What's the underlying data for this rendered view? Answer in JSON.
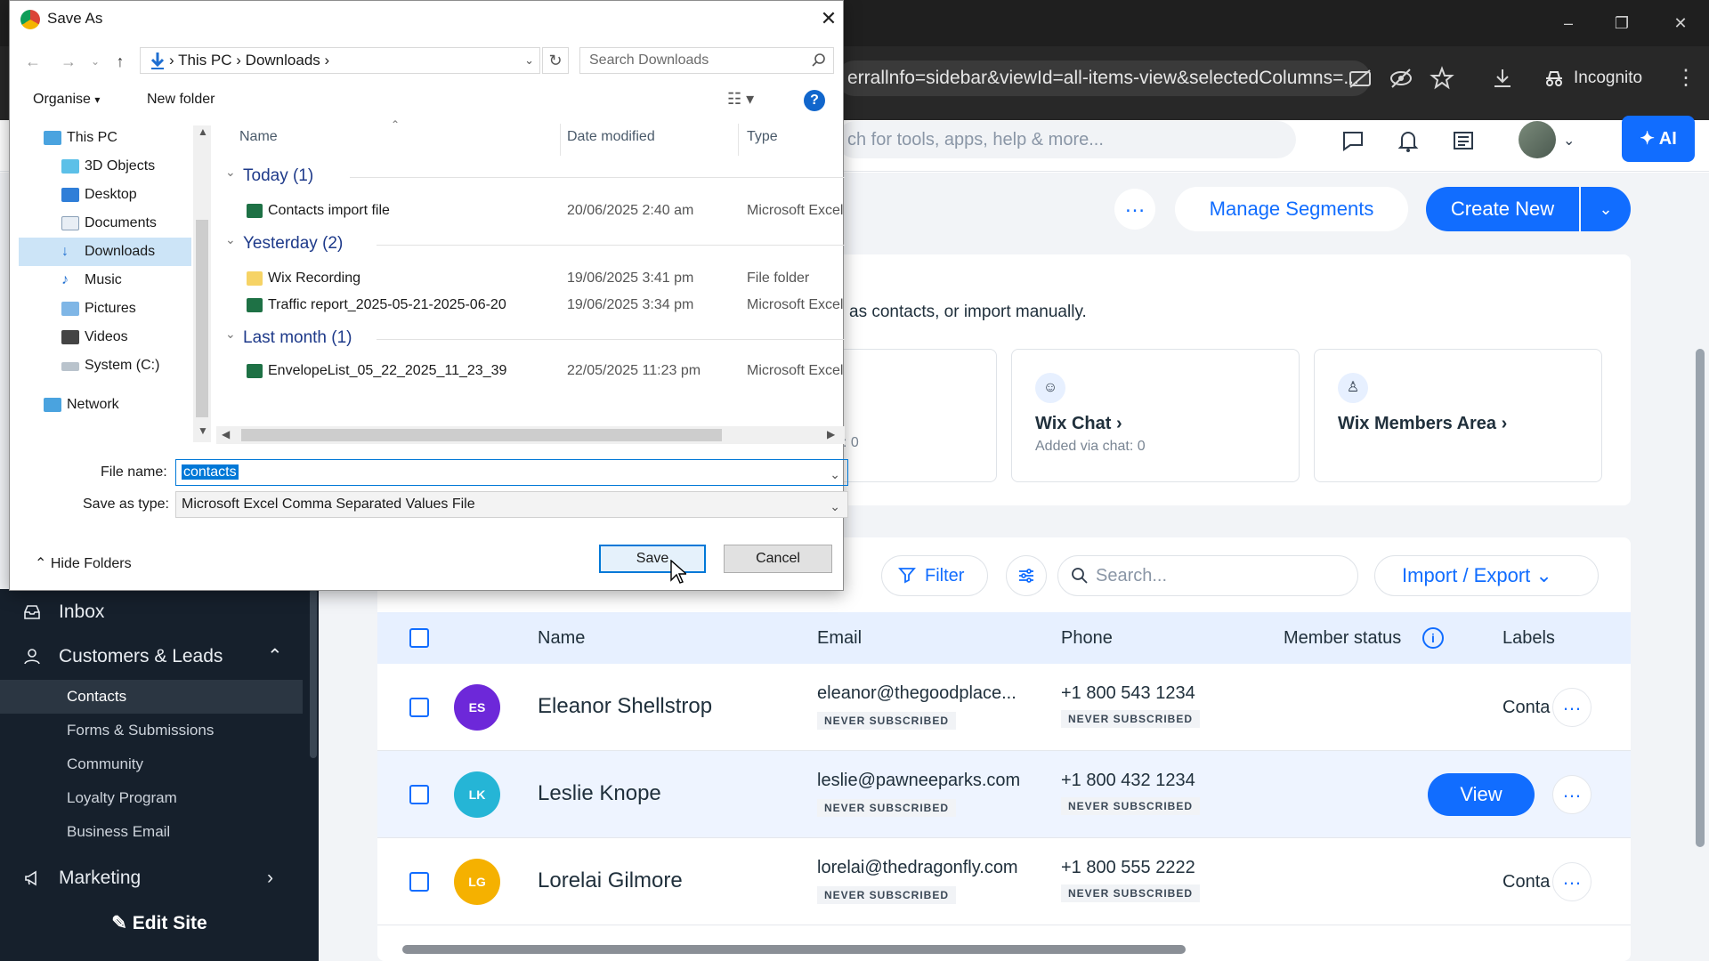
{
  "browser": {
    "address_text": "errallnfo=sidebar&viewId=all-items-view&selectedColumns=...",
    "incognito_label": "Incognito"
  },
  "wix": {
    "search_placeholder": "ch for tools, apps, help & more...",
    "ai_label": "AI",
    "header": {
      "manage_segments": "Manage Segments",
      "create_new": "Create New"
    },
    "sources": {
      "intro_text": "as contacts, or import manually.",
      "partial_sub": ": 0",
      "cards": [
        {
          "title": "Wix Chat",
          "subtitle": "Added via chat: 0",
          "icon": "chat-icon"
        },
        {
          "title": "Wix Members Area",
          "subtitle": "",
          "icon": "members-icon"
        }
      ]
    },
    "toolbar": {
      "filter": "Filter",
      "search_placeholder": "Search...",
      "import_export": "Import / Export"
    },
    "table": {
      "columns": [
        "Name",
        "Email",
        "Phone",
        "Member status",
        "Labels"
      ],
      "rows": [
        {
          "initials": "ES",
          "avatar_color": "#6d28d9",
          "name": "Eleanor Shellstrop",
          "email": "eleanor@thegoodplace...",
          "email_status": "NEVER SUBSCRIBED",
          "phone": "+1 800 543 1234",
          "phone_status": "NEVER SUBSCRIBED",
          "label": "Conta"
        },
        {
          "initials": "LK",
          "avatar_color": "#25b5d6",
          "name": "Leslie Knope",
          "email": "leslie@pawneeparks.com",
          "email_status": "NEVER SUBSCRIBED",
          "phone": "+1 800 432 1234",
          "phone_status": "NEVER SUBSCRIBED",
          "label": "",
          "action": "View"
        },
        {
          "initials": "LG",
          "avatar_color": "#f5b100",
          "name": "Lorelai Gilmore",
          "email": "lorelai@thedragonfly.com",
          "email_status": "NEVER SUBSCRIBED",
          "phone": "+1 800 555 2222",
          "phone_status": "NEVER SUBSCRIBED",
          "label": "Conta"
        }
      ]
    },
    "sidebar": {
      "items": [
        {
          "label": "Inbox",
          "icon": "inbox-icon"
        },
        {
          "label": "Customers & Leads",
          "icon": "person-icon"
        },
        {
          "label": "Marketing",
          "icon": "megaphone-icon"
        }
      ],
      "subitems": [
        "Contacts",
        "Forms & Submissions",
        "Community",
        "Loyalty Program",
        "Business Email"
      ],
      "edit_site": "Edit Site"
    }
  },
  "dialog": {
    "title": "Save As",
    "path": [
      "This PC",
      "Downloads"
    ],
    "search_placeholder": "Search Downloads",
    "organise": "Organise",
    "new_folder": "New folder",
    "nav_items": [
      "This PC",
      "3D Objects",
      "Desktop",
      "Documents",
      "Downloads",
      "Music",
      "Pictures",
      "Videos",
      "System (C:)",
      "Network"
    ],
    "columns": [
      "Name",
      "Date modified",
      "Type"
    ],
    "groups": [
      {
        "label": "Today (1)",
        "files": [
          {
            "name": "Contacts import file",
            "date": "20/06/2025 2:40 am",
            "type": "Microsoft Excel",
            "icon": "excel-icon"
          }
        ]
      },
      {
        "label": "Yesterday (2)",
        "files": [
          {
            "name": "Wix Recording",
            "date": "19/06/2025 3:41 pm",
            "type": "File folder",
            "icon": "folder-icon"
          },
          {
            "name": "Traffic report_2025-05-21-2025-06-20",
            "date": "19/06/2025 3:34 pm",
            "type": "Microsoft Excel",
            "icon": "excel-icon"
          }
        ]
      },
      {
        "label": "Last month (1)",
        "files": [
          {
            "name": "EnvelopeList_05_22_2025_11_23_39",
            "date": "22/05/2025 11:23 pm",
            "type": "Microsoft Excel",
            "icon": "excel-icon"
          }
        ]
      }
    ],
    "file_name_label": "File name:",
    "file_name": "contacts",
    "save_type_label": "Save as type:",
    "save_type": "Microsoft Excel Comma Separated Values File",
    "hide_folders": "Hide Folders",
    "save": "Save",
    "cancel": "Cancel"
  }
}
